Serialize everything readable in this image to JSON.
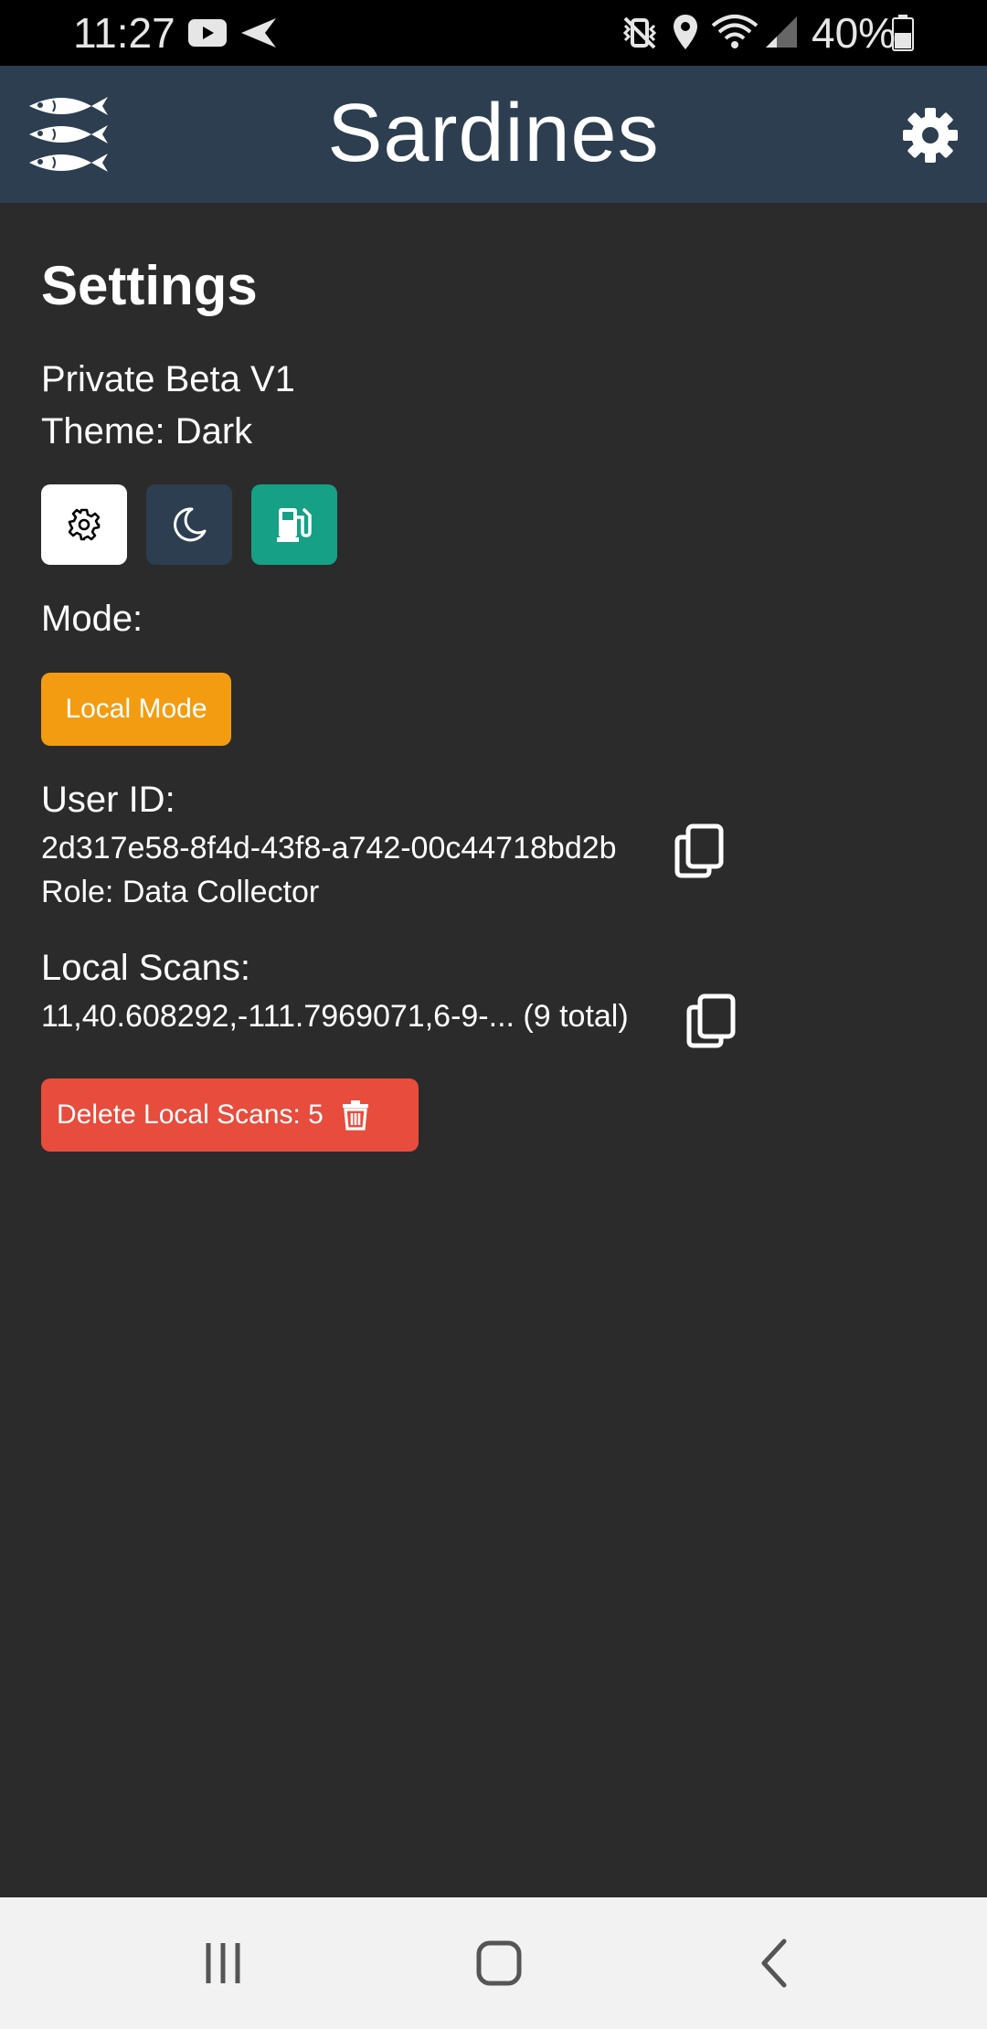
{
  "status_bar": {
    "time": "11:27",
    "battery_percent": "40%",
    "icons": [
      "youtube-icon",
      "send-icon",
      "vibrate-icon",
      "location-icon",
      "wifi-icon",
      "signal-icon",
      "battery-icon"
    ]
  },
  "app_bar": {
    "title": "Sardines",
    "logo": "sardines-logo-icon",
    "settings_icon": "gear-icon",
    "color": "#2c3e50"
  },
  "settings": {
    "heading": "Settings",
    "version": "Private Beta V1",
    "theme_text": "Theme: Dark",
    "theme_buttons": [
      {
        "icon": "gear-icon",
        "color": "#ffffff"
      },
      {
        "icon": "moon-icon",
        "color": "#2c3e50"
      },
      {
        "icon": "fuel-pump-icon",
        "color": "#16a085"
      }
    ],
    "mode_label": "Mode:",
    "mode_button": "Local Mode",
    "mode_color": "#f39c12",
    "user_id_label": "User ID:",
    "user_id": "2d317e58-8f4d-43f8-a742-00c44718bd2b",
    "role": "Role: Data Collector",
    "local_scans_label": "Local Scans:",
    "local_scans_value": "11,40.608292,-111.7969071,6-9-... (9 total)",
    "delete_button": "Delete Local Scans: 5",
    "delete_color": "#e74c3c"
  },
  "nav_bar": {
    "buttons": [
      "recent-apps-icon",
      "home-icon",
      "back-icon"
    ]
  }
}
